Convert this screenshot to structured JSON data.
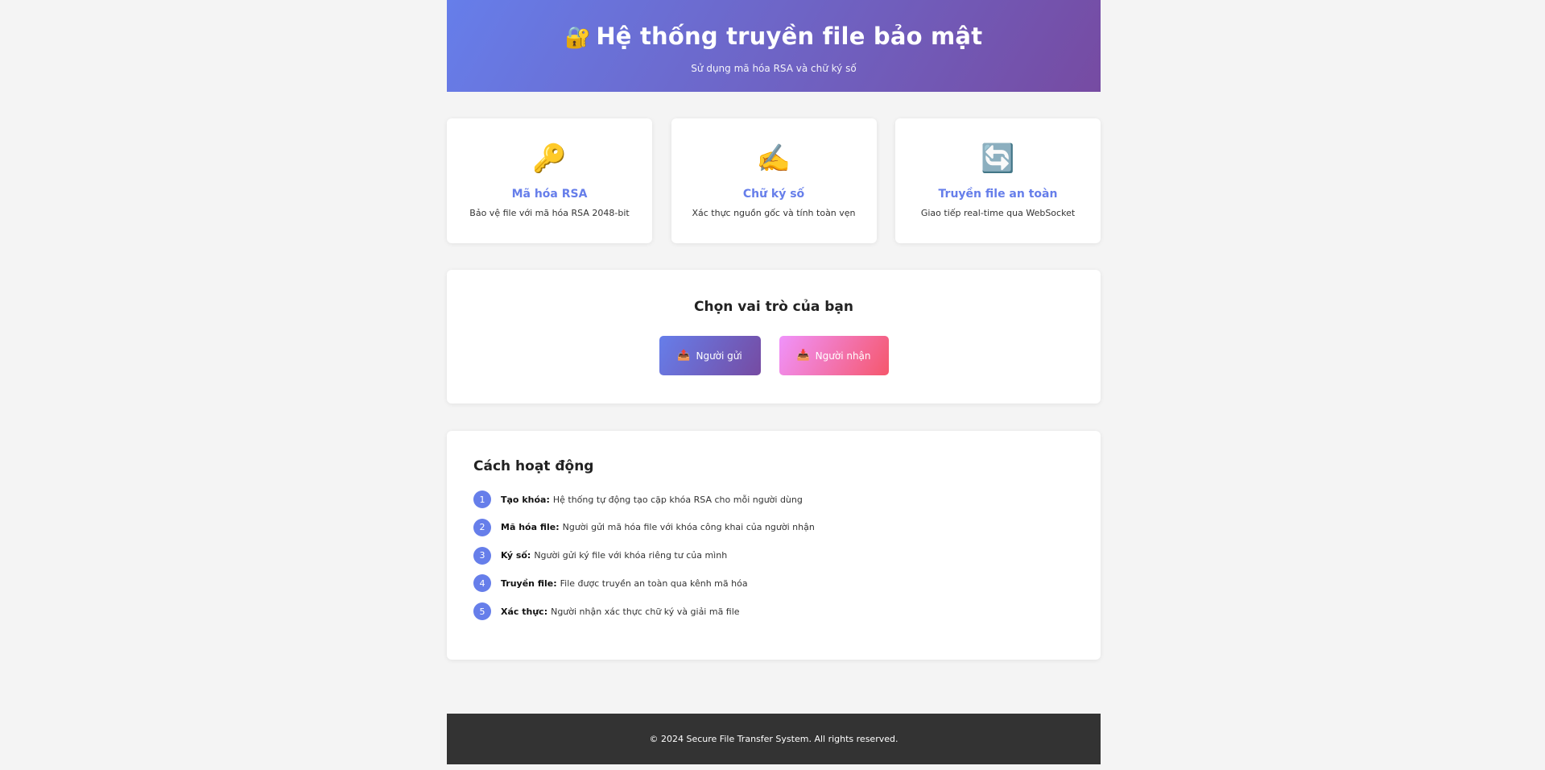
{
  "header": {
    "icon": "🔐",
    "title": "Hệ thống truyền file bảo mật",
    "subtitle": "Sử dụng mã hóa RSA và chữ ký số"
  },
  "features": [
    {
      "icon": "🔑",
      "icon_name": "key-icon",
      "title": "Mã hóa RSA",
      "description": "Bảo vệ file với mã hóa RSA 2048-bit"
    },
    {
      "icon": "✍️",
      "icon_name": "writing-hand-icon",
      "title": "Chữ ký số",
      "description": "Xác thực nguồn gốc và tính toàn vẹn"
    },
    {
      "icon": "🔄",
      "icon_name": "refresh-icon",
      "title": "Truyền file an toàn",
      "description": "Giao tiếp real-time qua WebSocket"
    }
  ],
  "roles": {
    "heading": "Chọn vai trò của bạn",
    "sender": {
      "icon": "📤",
      "label": "Người gửi"
    },
    "receiver": {
      "icon": "📥",
      "label": "Người nhận"
    }
  },
  "how": {
    "heading": "Cách hoạt động",
    "steps": [
      {
        "num": "1",
        "title": "Tạo khóa:",
        "text": "Hệ thống tự động tạo cặp khóa RSA cho mỗi người dùng"
      },
      {
        "num": "2",
        "title": "Mã hóa file:",
        "text": "Người gửi mã hóa file với khóa công khai của người nhận"
      },
      {
        "num": "3",
        "title": "Ký số:",
        "text": "Người gửi ký file với khóa riêng tư của mình"
      },
      {
        "num": "4",
        "title": "Truyền file:",
        "text": "File được truyền an toàn qua kênh mã hóa"
      },
      {
        "num": "5",
        "title": "Xác thực:",
        "text": "Người nhận xác thực chữ ký và giải mã file"
      }
    ]
  },
  "footer": {
    "text": "© 2024 Secure File Transfer System. All rights reserved."
  },
  "colors": {
    "primary": "#667eea",
    "primary_dark": "#764ba2",
    "receiver_start": "#f093fb",
    "receiver_end": "#f5576c",
    "footer_bg": "#333333"
  }
}
